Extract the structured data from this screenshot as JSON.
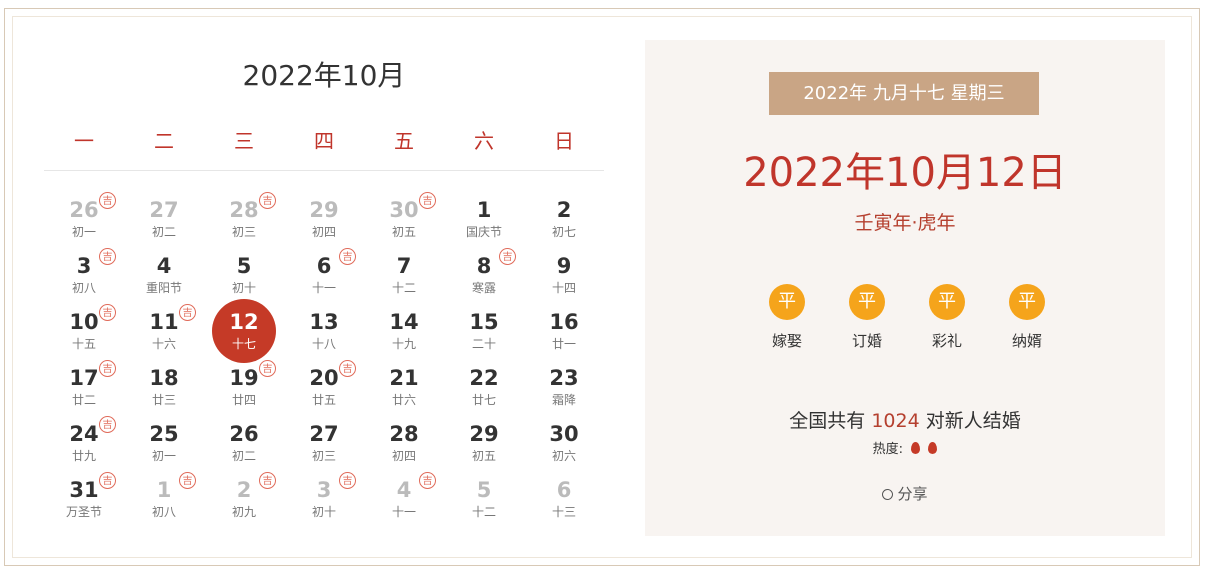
{
  "calendar": {
    "month_title": "2022年10月",
    "weekdays": [
      "一",
      "二",
      "三",
      "四",
      "五",
      "六",
      "日"
    ],
    "weeks": [
      [
        {
          "day": "26",
          "lunar": "初一",
          "ji": true,
          "dim": true
        },
        {
          "day": "27",
          "lunar": "初二",
          "ji": false,
          "dim": true
        },
        {
          "day": "28",
          "lunar": "初三",
          "ji": true,
          "dim": true
        },
        {
          "day": "29",
          "lunar": "初四",
          "ji": false,
          "dim": true
        },
        {
          "day": "30",
          "lunar": "初五",
          "ji": true,
          "dim": true
        },
        {
          "day": "1",
          "lunar": "国庆节",
          "ji": false,
          "dim": false
        },
        {
          "day": "2",
          "lunar": "初七",
          "ji": false,
          "dim": false
        }
      ],
      [
        {
          "day": "3",
          "lunar": "初八",
          "ji": true,
          "dim": false
        },
        {
          "day": "4",
          "lunar": "重阳节",
          "ji": false,
          "dim": false
        },
        {
          "day": "5",
          "lunar": "初十",
          "ji": false,
          "dim": false
        },
        {
          "day": "6",
          "lunar": "十一",
          "ji": true,
          "dim": false
        },
        {
          "day": "7",
          "lunar": "十二",
          "ji": false,
          "dim": false
        },
        {
          "day": "8",
          "lunar": "寒露",
          "ji": true,
          "dim": false
        },
        {
          "day": "9",
          "lunar": "十四",
          "ji": false,
          "dim": false
        }
      ],
      [
        {
          "day": "10",
          "lunar": "十五",
          "ji": true,
          "dim": false
        },
        {
          "day": "11",
          "lunar": "十六",
          "ji": true,
          "dim": false
        },
        {
          "day": "12",
          "lunar": "十七",
          "ji": false,
          "dim": false,
          "selected": true
        },
        {
          "day": "13",
          "lunar": "十八",
          "ji": false,
          "dim": false
        },
        {
          "day": "14",
          "lunar": "十九",
          "ji": false,
          "dim": false
        },
        {
          "day": "15",
          "lunar": "二十",
          "ji": false,
          "dim": false
        },
        {
          "day": "16",
          "lunar": "廿一",
          "ji": false,
          "dim": false
        }
      ],
      [
        {
          "day": "17",
          "lunar": "廿二",
          "ji": true,
          "dim": false
        },
        {
          "day": "18",
          "lunar": "廿三",
          "ji": false,
          "dim": false
        },
        {
          "day": "19",
          "lunar": "廿四",
          "ji": true,
          "dim": false
        },
        {
          "day": "20",
          "lunar": "廿五",
          "ji": true,
          "dim": false
        },
        {
          "day": "21",
          "lunar": "廿六",
          "ji": false,
          "dim": false
        },
        {
          "day": "22",
          "lunar": "廿七",
          "ji": false,
          "dim": false
        },
        {
          "day": "23",
          "lunar": "霜降",
          "ji": false,
          "dim": false
        }
      ],
      [
        {
          "day": "24",
          "lunar": "廿九",
          "ji": true,
          "dim": false
        },
        {
          "day": "25",
          "lunar": "初一",
          "ji": false,
          "dim": false
        },
        {
          "day": "26",
          "lunar": "初二",
          "ji": false,
          "dim": false
        },
        {
          "day": "27",
          "lunar": "初三",
          "ji": false,
          "dim": false
        },
        {
          "day": "28",
          "lunar": "初四",
          "ji": false,
          "dim": false
        },
        {
          "day": "29",
          "lunar": "初五",
          "ji": false,
          "dim": false
        },
        {
          "day": "30",
          "lunar": "初六",
          "ji": false,
          "dim": false
        }
      ],
      [
        {
          "day": "31",
          "lunar": "万圣节",
          "ji": true,
          "dim": false
        },
        {
          "day": "1",
          "lunar": "初八",
          "ji": true,
          "dim": true
        },
        {
          "day": "2",
          "lunar": "初九",
          "ji": true,
          "dim": true
        },
        {
          "day": "3",
          "lunar": "初十",
          "ji": true,
          "dim": true
        },
        {
          "day": "4",
          "lunar": "十一",
          "ji": true,
          "dim": true
        },
        {
          "day": "5",
          "lunar": "十二",
          "ji": false,
          "dim": true
        },
        {
          "day": "6",
          "lunar": "十三",
          "ji": false,
          "dim": true
        }
      ]
    ],
    "ji_label": "吉"
  },
  "detail": {
    "badge": "2022年 九月十七 星期三",
    "big_date": "2022年10月12日",
    "ganzhi": "壬寅年·虎年",
    "items": [
      {
        "coin": "平",
        "label": "嫁娶"
      },
      {
        "coin": "平",
        "label": "订婚"
      },
      {
        "coin": "平",
        "label": "彩礼"
      },
      {
        "coin": "平",
        "label": "纳婿"
      }
    ],
    "couples_prefix": "全国共有",
    "couples_count": "1024",
    "couples_suffix": "对新人结婚",
    "heat_label": "热度:",
    "share_label": "分享"
  },
  "colors": {
    "accent_red": "#c0352b",
    "selected_circle": "#c53a27",
    "badge_bg": "#c9a585",
    "coin_orange": "#f5a41b",
    "panel_bg": "#f8f4f1"
  },
  "icons": {
    "ji": "ji-stamp-icon",
    "flame": "flame-icon",
    "share": "share-icon"
  }
}
